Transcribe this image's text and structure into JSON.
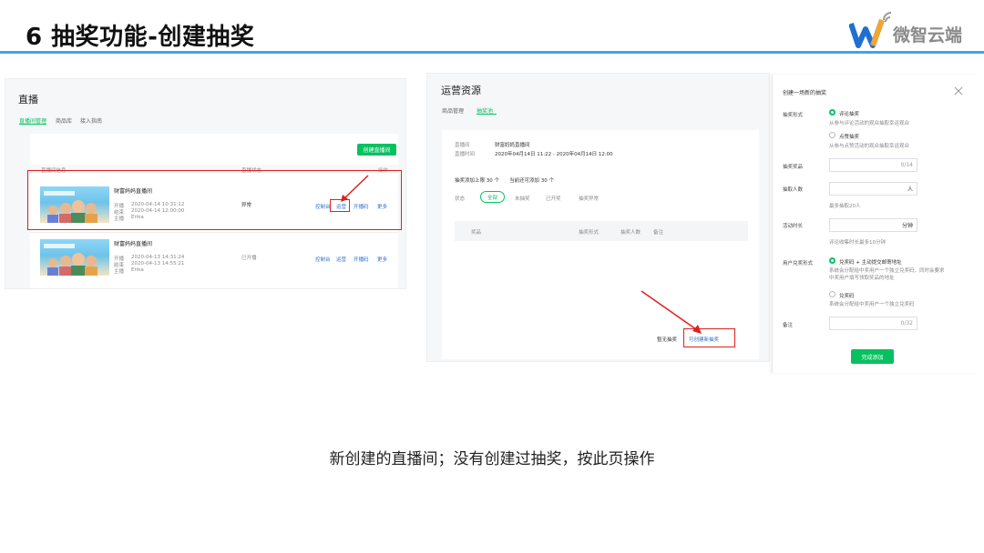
{
  "slide": {
    "title": "6 抽奖功能-创建抽奖",
    "logo_text": "微智云端",
    "caption": "新创建的直播间；没有创建过抽奖，按此页操作"
  },
  "left_panel": {
    "title": "直播",
    "tabs": [
      "直播间管理",
      "商品库",
      "接入指南"
    ],
    "create_button": "创建直播间",
    "table_headers": [
      "直播间信息",
      "直播状态",
      "操作"
    ],
    "rows": [
      {
        "name": "财富妈妈直播间",
        "start_label": "开播",
        "start": "2020-04-14 10:31:12",
        "end_label": "结束",
        "end": "2020-04-14 12:00:00",
        "host_label": "主播",
        "host": "Erika",
        "status": "异常",
        "actions": [
          "控制台",
          "运营",
          "开播码",
          "更多"
        ]
      },
      {
        "name": "财富妈妈直播间",
        "start_label": "开播",
        "start": "2020-04-13 14:31:24",
        "end_label": "结束",
        "end": "2020-04-13 14:55:21",
        "host_label": "主播",
        "host": "Erika",
        "status": "已开播",
        "actions": [
          "控制台",
          "运营",
          "开播码",
          "更多"
        ]
      }
    ]
  },
  "middle_panel": {
    "title": "运营资源",
    "tabs": [
      "商品管理",
      "抽奖池"
    ],
    "room_label": "直播间",
    "room_value": "财富妈妈直播间",
    "time_label": "直播时间",
    "time_value": "2020年04月14日 11:22 - 2020年04月14日 12:00",
    "limit_text": "抽奖添加上限 30 个",
    "remain_text": "当前还可添加 30 个",
    "filter_label": "状态",
    "filters": [
      "全部",
      "未抽奖",
      "已开奖",
      "抽奖异常"
    ],
    "table_headers": [
      "奖品",
      "抽奖形式",
      "抽奖人数",
      "备注"
    ],
    "empty_text": "暂无抽奖",
    "create_link": "可创建新抽奖"
  },
  "right_panel": {
    "title": "创建一场新的抽奖",
    "form_label": "抽奖形式",
    "option1": "评论抽奖",
    "option1_desc": "从参与评论活动的观众抽取幸运观众",
    "option2": "点赞抽奖",
    "option2_desc": "从参与点赞活动的观众抽取幸运观众",
    "prize_label": "抽奖奖品",
    "prize_count": "0/14",
    "people_label": "抽取人数",
    "people_unit": "人",
    "people_hint": "最多抽取20人",
    "duration_label": "活动时长",
    "duration_unit": "分钟",
    "duration_hint": "评论收集时长最多10分钟",
    "claim_label": "用户兑奖形式",
    "claim1": "兑奖码 + 主动提交邮寄地址",
    "claim1_desc1": "系统会分配给中奖用户一个独立兑奖码，同时会要求",
    "claim1_desc2": "中奖用户填写领取奖品的地址",
    "claim2": "兑奖码",
    "claim2_desc": "系统会分配给中奖用户一个独立兑奖码",
    "note_label": "备注",
    "note_count": "0/32",
    "submit": "完成添加"
  },
  "colors": {
    "accent": "#07c160",
    "title_rule": "#39a9e3",
    "highlight": "#e02020",
    "link": "#2b6fce"
  }
}
